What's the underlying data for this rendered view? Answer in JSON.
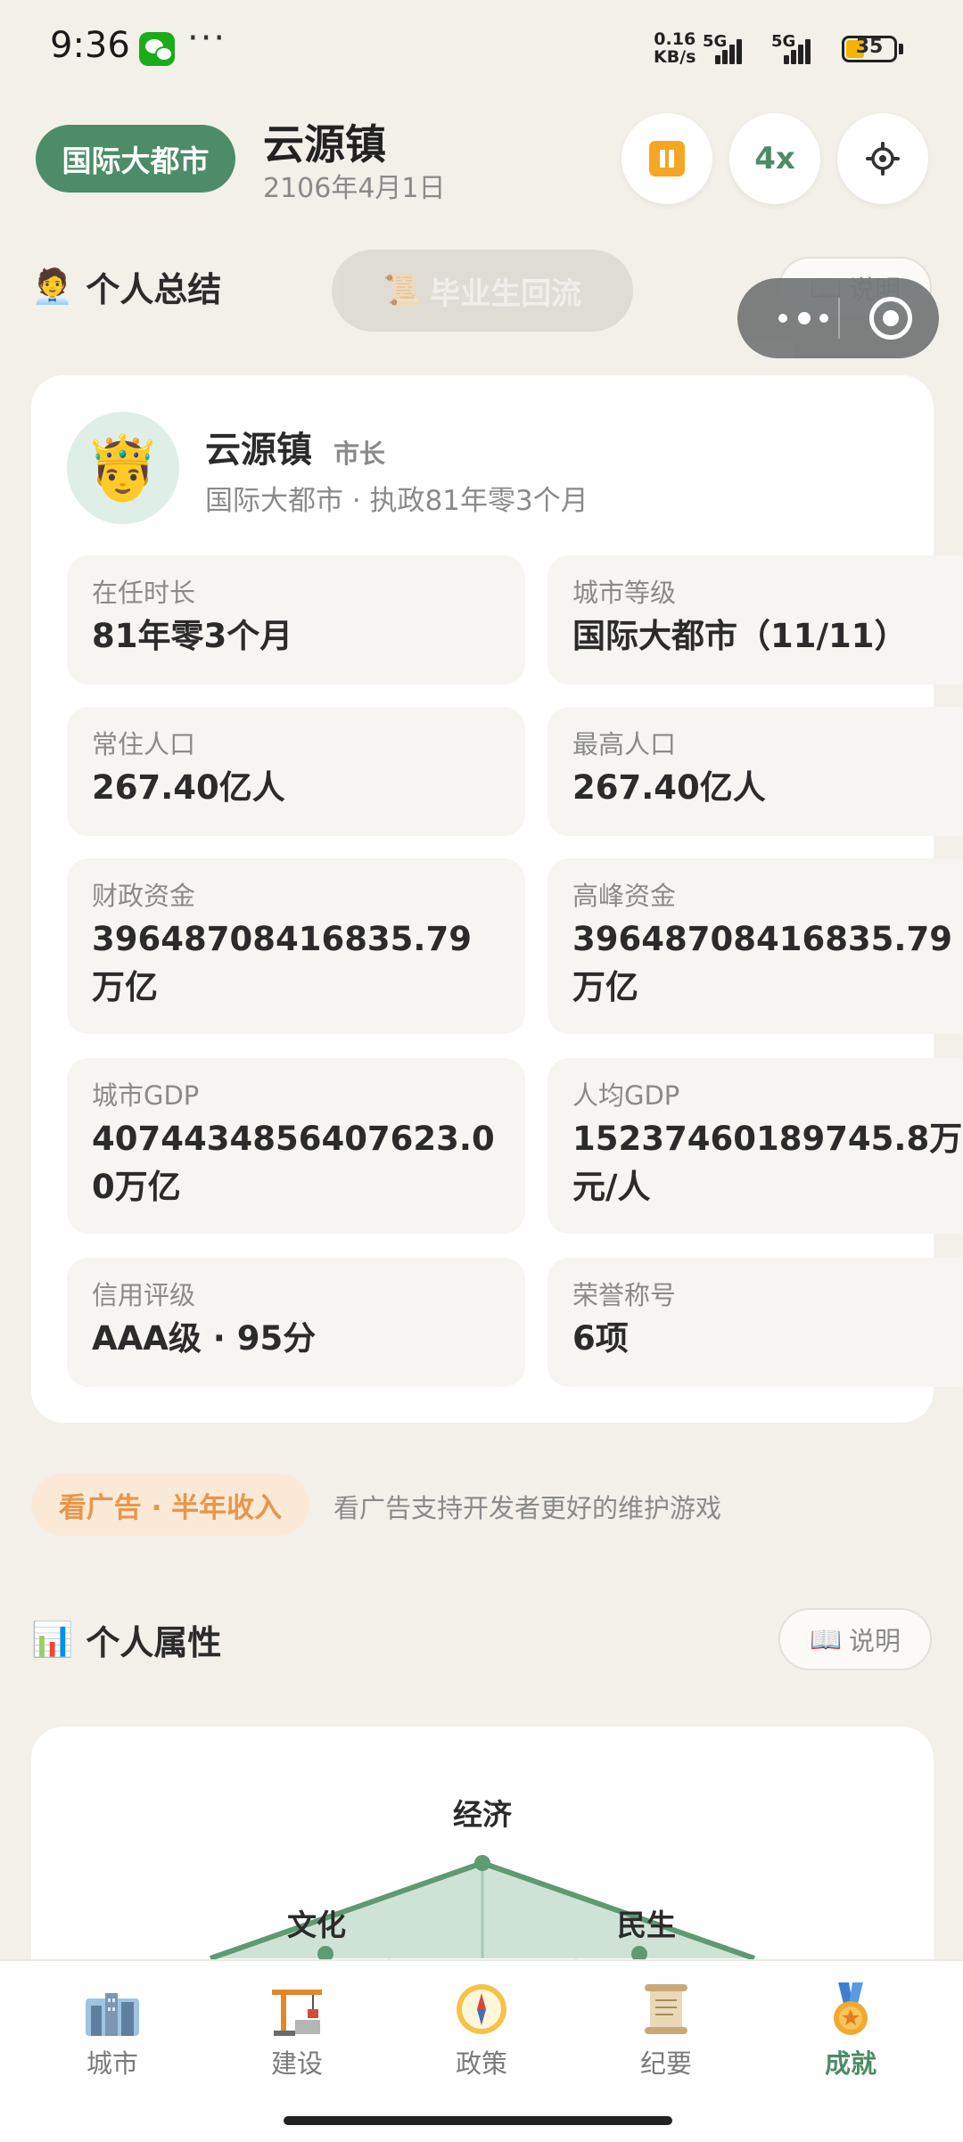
{
  "status_bar": {
    "time": "9:36",
    "net_speed_value": "0.16",
    "net_speed_unit": "KB/s",
    "signal1_label": "5G",
    "signal2_label": "5G",
    "battery": "35",
    "more": "···"
  },
  "header": {
    "city_level": "国际大都市",
    "city_name": "云源镇",
    "date": "2106年4月1日",
    "speed": "4x"
  },
  "personal_summary": {
    "title": "个人总结",
    "graduate_button": "毕业生回流",
    "explain_button": "说明",
    "player_name": "云源镇",
    "player_role": "市长",
    "player_sub": "国际大都市 · 执政81年零3个月",
    "avatar_emoji": "🤴",
    "stats": [
      {
        "label": "在任时长",
        "value": "81年零3个月"
      },
      {
        "label": "城市等级",
        "value": "国际大都市（11/11）"
      },
      {
        "label": "常住人口",
        "value": "267.40亿人"
      },
      {
        "label": "最高人口",
        "value": "267.40亿人"
      },
      {
        "label": "财政资金",
        "value": "39648708416835.79万亿"
      },
      {
        "label": "高峰资金",
        "value": "39648708416835.79万亿"
      },
      {
        "label": "城市GDP",
        "value": "4074434856407623.00万亿"
      },
      {
        "label": "人均GDP",
        "value": "15237460189745.8万元/人"
      },
      {
        "label": "信用评级",
        "value": "AAA级 · 95分"
      },
      {
        "label": "荣誉称号",
        "value": "6项"
      }
    ]
  },
  "ad": {
    "button": "看广告 · 半年收入",
    "description": "看广告支持开发者更好的维护游戏"
  },
  "personal_attributes": {
    "title": "个人属性",
    "explain_button": "说明",
    "radar_labels": {
      "top": "经济",
      "left": "文化",
      "right": "民生"
    }
  },
  "nav": [
    {
      "label": "城市",
      "icon": "city-icon"
    },
    {
      "label": "建设",
      "icon": "crane-icon"
    },
    {
      "label": "政策",
      "icon": "compass-icon"
    },
    {
      "label": "纪要",
      "icon": "scroll-icon"
    },
    {
      "label": "成就",
      "icon": "medal-icon",
      "active": true
    }
  ],
  "colors": {
    "accent_green": "#4c8c68",
    "pause_orange": "#f5a623",
    "background": "#f3f0ea"
  }
}
